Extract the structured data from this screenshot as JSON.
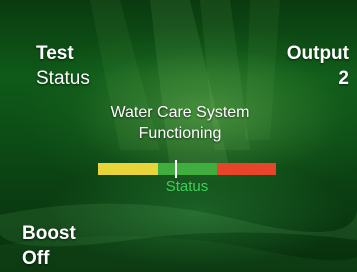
{
  "top_left": {
    "label": "Test",
    "sub_label": "Status"
  },
  "top_right": {
    "label": "Output",
    "value": "2"
  },
  "message": {
    "line1": "Water Care System",
    "line2": "Functioning"
  },
  "status_bar": {
    "label": "Status",
    "level": 0.44,
    "colors": {
      "low": "#e8d53a",
      "ok": "#3fae3f",
      "high": "#e8442a",
      "label": "#3ecf5a"
    }
  },
  "bottom_left": {
    "label": "Boost",
    "value": "Off"
  }
}
